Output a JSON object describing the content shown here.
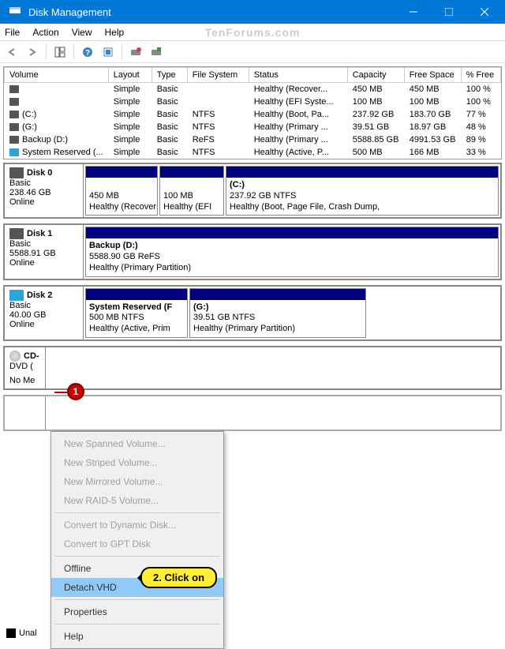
{
  "window": {
    "title": "Disk Management"
  },
  "menu": {
    "file": "File",
    "action": "Action",
    "view": "View",
    "help": "Help"
  },
  "watermark": "TenForums.com",
  "columns": {
    "volume": "Volume",
    "layout": "Layout",
    "type": "Type",
    "fs": "File System",
    "status": "Status",
    "capacity": "Capacity",
    "free": "Free Space",
    "pct": "% Free"
  },
  "volumes": [
    {
      "name": "",
      "layout": "Simple",
      "type": "Basic",
      "fs": "",
      "status": "Healthy (Recover...",
      "capacity": "450 MB",
      "free": "450 MB",
      "pct": "100 %",
      "icon": "dark"
    },
    {
      "name": "",
      "layout": "Simple",
      "type": "Basic",
      "fs": "",
      "status": "Healthy (EFI Syste...",
      "capacity": "100 MB",
      "free": "100 MB",
      "pct": "100 %",
      "icon": "dark"
    },
    {
      "name": "(C:)",
      "layout": "Simple",
      "type": "Basic",
      "fs": "NTFS",
      "status": "Healthy (Boot, Pa...",
      "capacity": "237.92 GB",
      "free": "183.70 GB",
      "pct": "77 %",
      "icon": "dark"
    },
    {
      "name": "(G:)",
      "layout": "Simple",
      "type": "Basic",
      "fs": "NTFS",
      "status": "Healthy (Primary ...",
      "capacity": "39.51 GB",
      "free": "18.97 GB",
      "pct": "48 %",
      "icon": "dark"
    },
    {
      "name": "Backup (D:)",
      "layout": "Simple",
      "type": "Basic",
      "fs": "ReFS",
      "status": "Healthy (Primary ...",
      "capacity": "5588.85 GB",
      "free": "4991.53 GB",
      "pct": "89 %",
      "icon": "dark"
    },
    {
      "name": "System Reserved (...",
      "layout": "Simple",
      "type": "Basic",
      "fs": "NTFS",
      "status": "Healthy (Active, P...",
      "capacity": "500 MB",
      "free": "166 MB",
      "pct": "33 %",
      "icon": "blue"
    }
  ],
  "disks": {
    "d0": {
      "title": "Disk 0",
      "type": "Basic",
      "size": "238.46 GB",
      "state": "Online",
      "p0": {
        "l1": "",
        "l2": "450 MB",
        "l3": "Healthy (Recover"
      },
      "p1": {
        "l1": "",
        "l2": "100 MB",
        "l3": "Healthy (EFI"
      },
      "p2": {
        "l1": "(C:)",
        "l2": "237.92 GB NTFS",
        "l3": "Healthy (Boot, Page File, Crash Dump,"
      }
    },
    "d1": {
      "title": "Disk 1",
      "type": "Basic",
      "size": "5588.91 GB",
      "state": "Online",
      "p0": {
        "l1": "Backup  (D:)",
        "l2": "5588.90 GB ReFS",
        "l3": "Healthy (Primary Partition)"
      }
    },
    "d2": {
      "title": "Disk 2",
      "type": "Basic",
      "size": "40.00 GB",
      "state": "Online",
      "p0": {
        "l1": "System Reserved  (F",
        "l2": "500 MB NTFS",
        "l3": "Healthy (Active, Prim"
      },
      "p1": {
        "l1": "(G:)",
        "l2": "39.51 GB NTFS",
        "l3": "Healthy (Primary Partition)"
      }
    },
    "cd": {
      "title": "CD-",
      "type": "DVD (",
      "nomedia": "No Me"
    }
  },
  "ctx": {
    "spanned": "New Spanned Volume...",
    "striped": "New Striped Volume...",
    "mirrored": "New Mirrored Volume...",
    "raid5": "New RAID-5 Volume...",
    "dynamic": "Convert to Dynamic Disk...",
    "gpt": "Convert to GPT Disk",
    "offline": "Offline",
    "detach": "Detach VHD",
    "props": "Properties",
    "help": "Help"
  },
  "annotations": {
    "step1": "1",
    "step2": "2. Click on",
    "unallocated": "Unal"
  }
}
